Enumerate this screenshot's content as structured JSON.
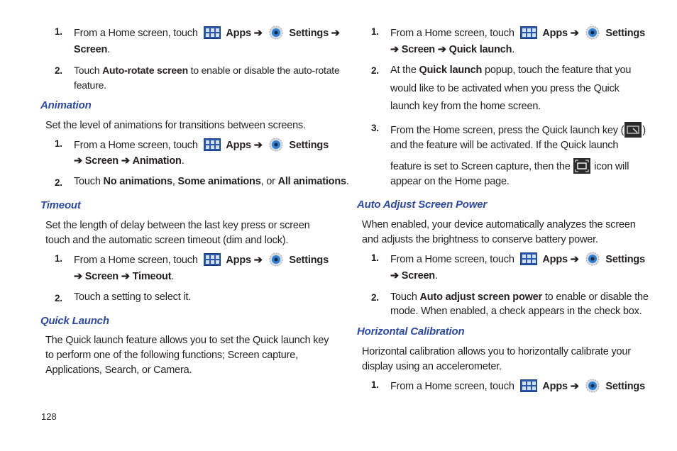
{
  "page_number": "128",
  "left": {
    "intro_steps": [
      {
        "num": "1.",
        "prefix": "From a Home screen, touch",
        "apps": "Apps",
        "settings": "Settings",
        "arrow": "➔",
        "line2": "Screen",
        "end": "."
      },
      {
        "num": "2.",
        "pre": "Touch ",
        "bold": "Auto-rotate screen",
        "post": " to enable or disable the auto-rotate",
        "line2": "feature."
      }
    ],
    "animation": {
      "heading": "Animation",
      "body": "Set the level of animations for transitions between screens.",
      "step1": {
        "num": "1.",
        "prefix": "From a Home screen, touch",
        "apps": "Apps",
        "settings": "Settings",
        "line2a": "Screen",
        "line2b": "Animation"
      },
      "step2": {
        "num": "2.",
        "pre": "Touch ",
        "b1": "No animations",
        "sep1": ", ",
        "b2": "Some animations",
        "sep2": ", or ",
        "b3": "All animations",
        "end": "."
      }
    },
    "timeout": {
      "heading": "Timeout",
      "body1": "Set the length of delay between the last key press or screen",
      "body2": "touch and the automatic screen timeout (dim and lock).",
      "step1": {
        "num": "1.",
        "prefix": "From a Home screen, touch",
        "apps": "Apps",
        "settings": "Settings",
        "line2a": "Screen",
        "line2b": "Timeout"
      },
      "step2": {
        "num": "2.",
        "text": "Touch a setting to select it."
      }
    },
    "quick_launch": {
      "heading": "Quick Launch",
      "body1": "The Quick launch feature allows you to set the Quick launch key",
      "body2": "to perform one of the following functions; Screen capture,",
      "body3": "Applications, Search, or Camera."
    }
  },
  "right": {
    "ql_steps": {
      "step1": {
        "num": "1.",
        "prefix": "From a Home screen, touch",
        "apps": "Apps",
        "settings": "Settings",
        "line2a": "Screen",
        "line2b": "Quick launch"
      },
      "step2": {
        "num": "2.",
        "pre": "At the ",
        "bold": "Quick launch",
        "post": " popup, touch the feature that you",
        "line2": "would like to be activated when you press the Quick",
        "line3": "launch key from the home screen."
      },
      "step3": {
        "num": "3.",
        "line1": "From the Home screen, press the Quick launch key (",
        "line1end": ")",
        "line2": "and the feature will be activated. If the Quick launch",
        "line3a": "feature is set to Screen capture, then the",
        "line3b": "icon will",
        "line4": "appear on the Home page."
      }
    },
    "auto_adjust": {
      "heading": "Auto Adjust Screen Power",
      "body1": "When enabled, your device automatically analyzes the screen",
      "body2": "and adjusts the brightness to conserve battery power.",
      "step1": {
        "num": "1.",
        "prefix": "From a Home screen, touch",
        "apps": "Apps",
        "settings": "Settings",
        "line2a": "Screen"
      },
      "step2": {
        "num": "2.",
        "pre": "Touch ",
        "bold": "Auto adjust screen power",
        "post": " to enable or disable the",
        "line2": "mode. When enabled, a check appears in the check box."
      }
    },
    "horizontal": {
      "heading": "Horizontal Calibration",
      "body1": "Horizontal calibration allows you to horizontally calibrate your",
      "body2": "display using an accelerometer.",
      "step1": {
        "num": "1.",
        "prefix": "From a Home screen, touch",
        "apps": "Apps",
        "settings": "Settings"
      }
    },
    "arrow": "➔"
  }
}
